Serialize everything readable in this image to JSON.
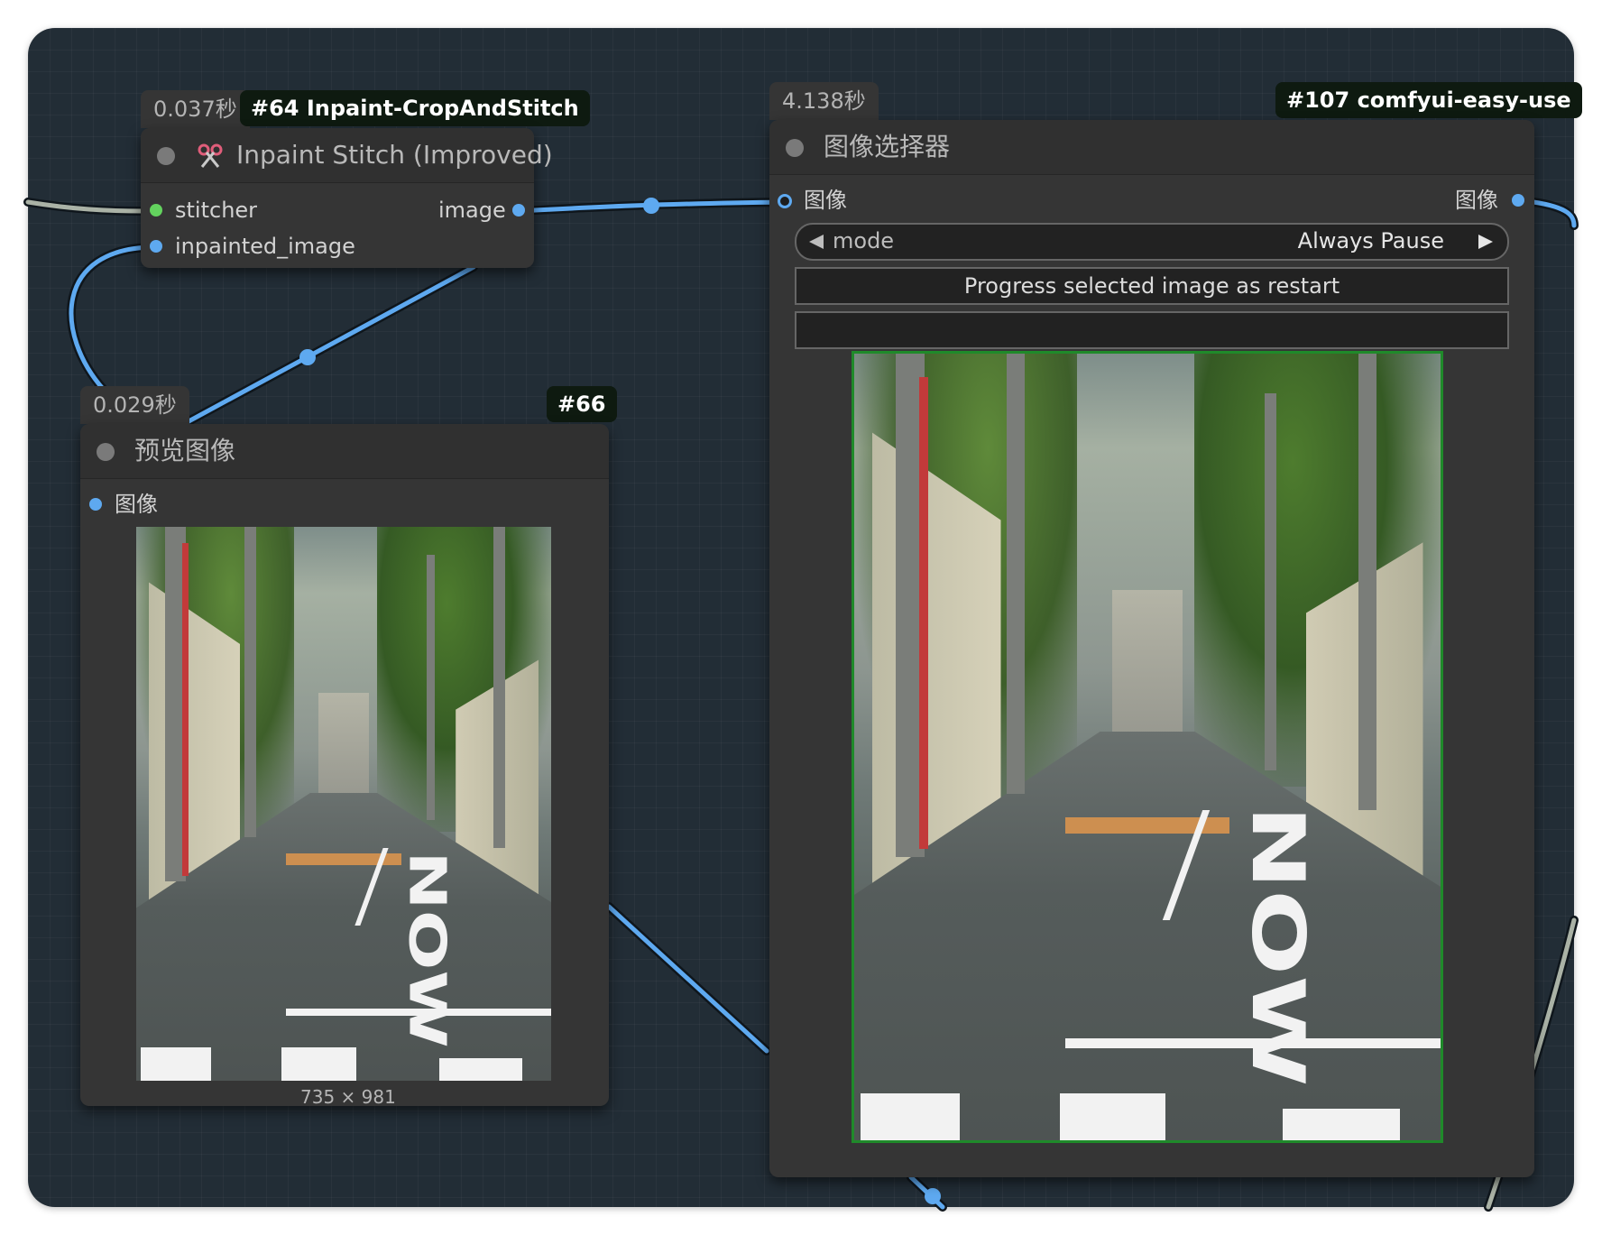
{
  "nodes": {
    "inpaint_stitch": {
      "time": "0.037秒",
      "badge": "#64 Inpaint-CropAndStitch",
      "title": "Inpaint Stitch (Improved)",
      "inputs": [
        "stitcher",
        "inpainted_image"
      ],
      "output": "image"
    },
    "preview_image": {
      "time": "0.029秒",
      "badge": "#66",
      "title": "预览图像",
      "input": "图像",
      "image_size": "735 × 981"
    },
    "image_chooser": {
      "time": "4.138秒",
      "badge": "#107 comfyui-easy-use",
      "title": "图像选择器",
      "input": "图像",
      "output": "图像",
      "mode_label": "mode",
      "mode_value": "Always Pause",
      "progress_button": "Progress selected image as restart",
      "text_value": ""
    }
  },
  "colors": {
    "canvas": "#222d36",
    "node_body": "#353535",
    "link": "#5ea9f0",
    "link_dark": "#0f161c",
    "selected_border": "#1f8a2a"
  },
  "icons": {
    "scissors": "scissors-icon",
    "arrow_left": "arrow-left-icon",
    "arrow_right": "arrow-right-icon"
  }
}
